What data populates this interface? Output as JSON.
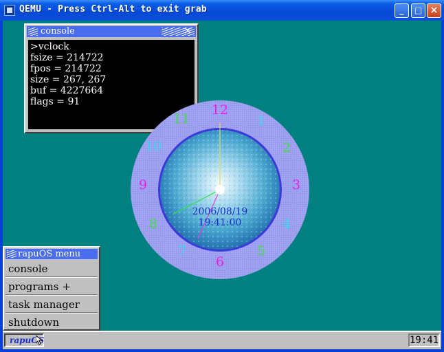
{
  "window": {
    "title": "QEMU - Press Ctrl-Alt to exit grab",
    "minimize_label": "_",
    "maximize_label": "□",
    "close_label": "×"
  },
  "console": {
    "title": "console",
    "lines": [
      ">vclock",
      "fsize = 214722",
      "fpos = 214722",
      "size = 267, 267",
      "buf = 4227664",
      "flags = 91"
    ]
  },
  "clock": {
    "numbers": [
      "12",
      "1",
      "2",
      "3",
      "4",
      "5",
      "6",
      "7",
      "8",
      "9",
      "10",
      "11"
    ],
    "date": "2006/08/19",
    "time": "19:41:00",
    "colors": {
      "magenta": "#e81ce8",
      "cyan": "#38d8f0",
      "green": "#40e040",
      "ring": "#9a9cf0",
      "date_text": "#1c2cc8"
    }
  },
  "menu": {
    "title": "rapuOS menu",
    "items": [
      "console",
      "programs +",
      "task manager",
      "shutdown"
    ]
  },
  "taskbar": {
    "start_label": "rapuOS",
    "clock": "19:41"
  },
  "colors": {
    "desktop": "#008080",
    "titlebar": "#4a6cf0",
    "panel": "#c0c0c0"
  }
}
